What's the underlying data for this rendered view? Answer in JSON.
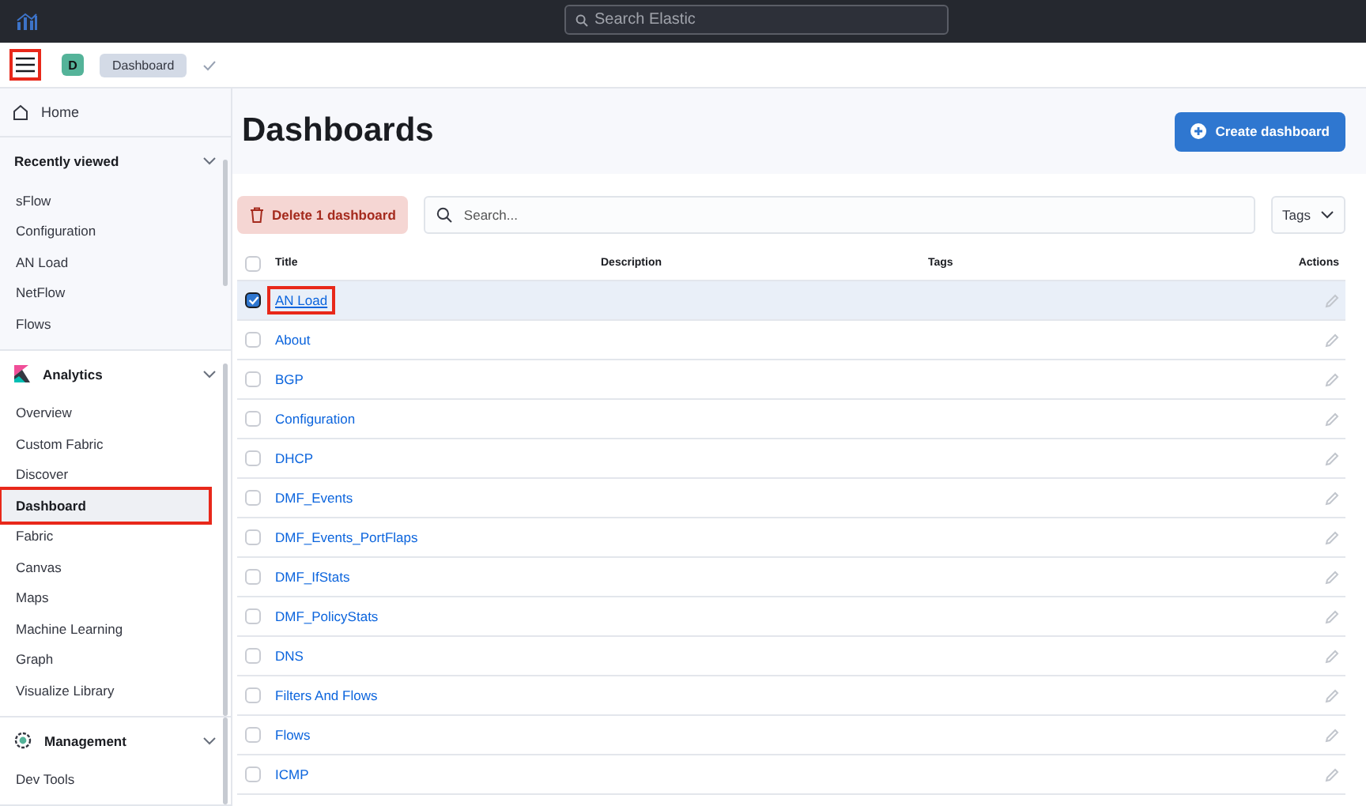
{
  "top_bar": {
    "search": {
      "placeholder": "Search Elastic"
    }
  },
  "nav_bar": {
    "menu_button": {
      "highlighted": true
    },
    "space_avatar": "D",
    "breadcrumb": "Dashboard"
  },
  "sidebar": {
    "home": "Home",
    "sections": [
      {
        "kind": "plain",
        "title": "Recently viewed",
        "expanded": true,
        "items": [
          {
            "label": "sFlow",
            "selected": false,
            "highlighted": false
          },
          {
            "label": "Configuration",
            "selected": false,
            "highlighted": false
          },
          {
            "label": "AN Load",
            "selected": false,
            "highlighted": false
          },
          {
            "label": "NetFlow",
            "selected": false,
            "highlighted": false
          },
          {
            "label": "Flows",
            "selected": false,
            "highlighted": false
          }
        ]
      },
      {
        "kind": "analytics",
        "title": "Analytics",
        "expanded": true,
        "items": [
          {
            "label": "Overview",
            "selected": false,
            "highlighted": false
          },
          {
            "label": "Custom Fabric",
            "selected": false,
            "highlighted": false
          },
          {
            "label": "Discover",
            "selected": false,
            "highlighted": false
          },
          {
            "label": "Dashboard",
            "selected": true,
            "highlighted": true
          },
          {
            "label": "Fabric",
            "selected": false,
            "highlighted": false
          },
          {
            "label": "Canvas",
            "selected": false,
            "highlighted": false
          },
          {
            "label": "Maps",
            "selected": false,
            "highlighted": false
          },
          {
            "label": "Machine Learning",
            "selected": false,
            "highlighted": false
          },
          {
            "label": "Graph",
            "selected": false,
            "highlighted": false
          },
          {
            "label": "Visualize Library",
            "selected": false,
            "highlighted": false
          }
        ]
      },
      {
        "kind": "management",
        "title": "Management",
        "expanded": true,
        "items": [
          {
            "label": "Dev Tools",
            "selected": false,
            "highlighted": false
          }
        ]
      }
    ]
  },
  "page": {
    "title": "Dashboards",
    "create_button": "Create dashboard",
    "delete_button": "Delete 1 dashboard",
    "search": {
      "placeholder": "Search..."
    },
    "tags_filter": "Tags",
    "table": {
      "columns": [
        "Title",
        "Description",
        "Tags",
        "Actions"
      ],
      "all_checked": false,
      "rows": [
        {
          "title": "AN Load",
          "checked": true,
          "highlighted": true
        },
        {
          "title": "About",
          "checked": false,
          "highlighted": false
        },
        {
          "title": "BGP",
          "checked": false,
          "highlighted": false
        },
        {
          "title": "Configuration",
          "checked": false,
          "highlighted": false
        },
        {
          "title": "DHCP",
          "checked": false,
          "highlighted": false
        },
        {
          "title": "DMF_Events",
          "checked": false,
          "highlighted": false
        },
        {
          "title": "DMF_Events_PortFlaps",
          "checked": false,
          "highlighted": false
        },
        {
          "title": "DMF_IfStats",
          "checked": false,
          "highlighted": false
        },
        {
          "title": "DMF_PolicyStats",
          "checked": false,
          "highlighted": false
        },
        {
          "title": "DNS",
          "checked": false,
          "highlighted": false
        },
        {
          "title": "Filters And Flows",
          "checked": false,
          "highlighted": false
        },
        {
          "title": "Flows",
          "checked": false,
          "highlighted": false
        },
        {
          "title": "ICMP",
          "checked": false,
          "highlighted": false
        }
      ]
    }
  }
}
